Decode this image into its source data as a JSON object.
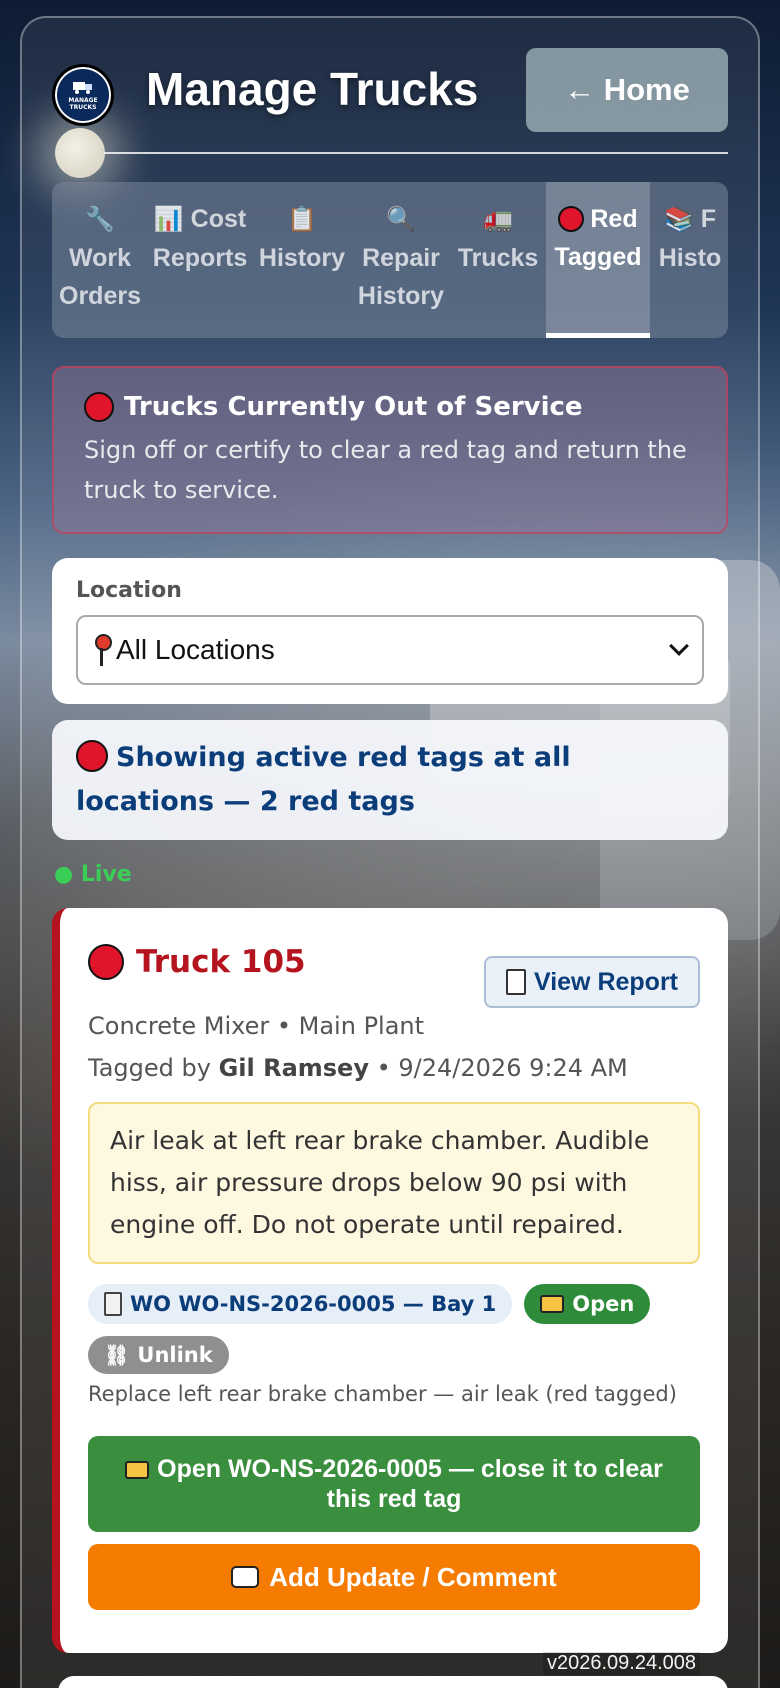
{
  "header": {
    "title": "Manage Trucks",
    "home_label": "← Home",
    "logo_text": "MANAGE TRUCKS"
  },
  "tabs": [
    {
      "icon": "wrench-icon",
      "line1": "Work",
      "line2": "Orders",
      "active": false
    },
    {
      "icon": "bar-chart-icon",
      "line1": "Cost",
      "line2": "Reports",
      "active": false
    },
    {
      "icon": "clipboard-icon",
      "line1": "",
      "line2": "History",
      "active": false
    },
    {
      "icon": "magnifier-icon",
      "line1": "Repair",
      "line2": "History",
      "active": false
    },
    {
      "icon": "truck-icon",
      "line1": "",
      "line2": "Trucks",
      "active": false
    },
    {
      "icon": "red-circle-icon",
      "line1": "Red",
      "line2": "Tagged",
      "active": true
    },
    {
      "icon": "books-icon",
      "line1": "F",
      "line2": "Histo",
      "active": false
    }
  ],
  "banner": {
    "title": "Trucks Currently Out of Service",
    "subtitle": "Sign off or certify to clear a red tag and return the truck to service."
  },
  "location": {
    "label": "Location",
    "selected": "All Locations"
  },
  "status": {
    "text": "Showing active red tags at all locations — 2 red tags"
  },
  "live_label": "● Live",
  "truck": {
    "name": "Truck 105",
    "view_report_label": "View Report",
    "meta": "Concrete Mixer • Main Plant",
    "tagged_by_prefix": "Tagged by",
    "tagged_by_name": "Gil Ramsey",
    "tagged_at": "• 9/24/2026 9:24 AM",
    "note": "Air leak at left rear brake chamber. Audible hiss, air pressure drops below 90 psi with engine off. Do not operate until repaired.",
    "wo_chip": "WO WO-NS-2026-0005 — Bay 1",
    "open_chip": "Open",
    "unlink_chip": "Unlink",
    "wo_description": "Replace left rear brake chamber — air leak (red tagged)",
    "open_wo_button": "Open WO-NS-2026-0005 — close it to clear this red tag",
    "add_update_button": "Add Update / Comment"
  },
  "version": "v2026.09.24.008",
  "colors": {
    "red_tag": "#b4141e",
    "open_green": "#2e8b3a",
    "action_orange": "#f57c00",
    "link_blue": "#0b3d7a"
  }
}
